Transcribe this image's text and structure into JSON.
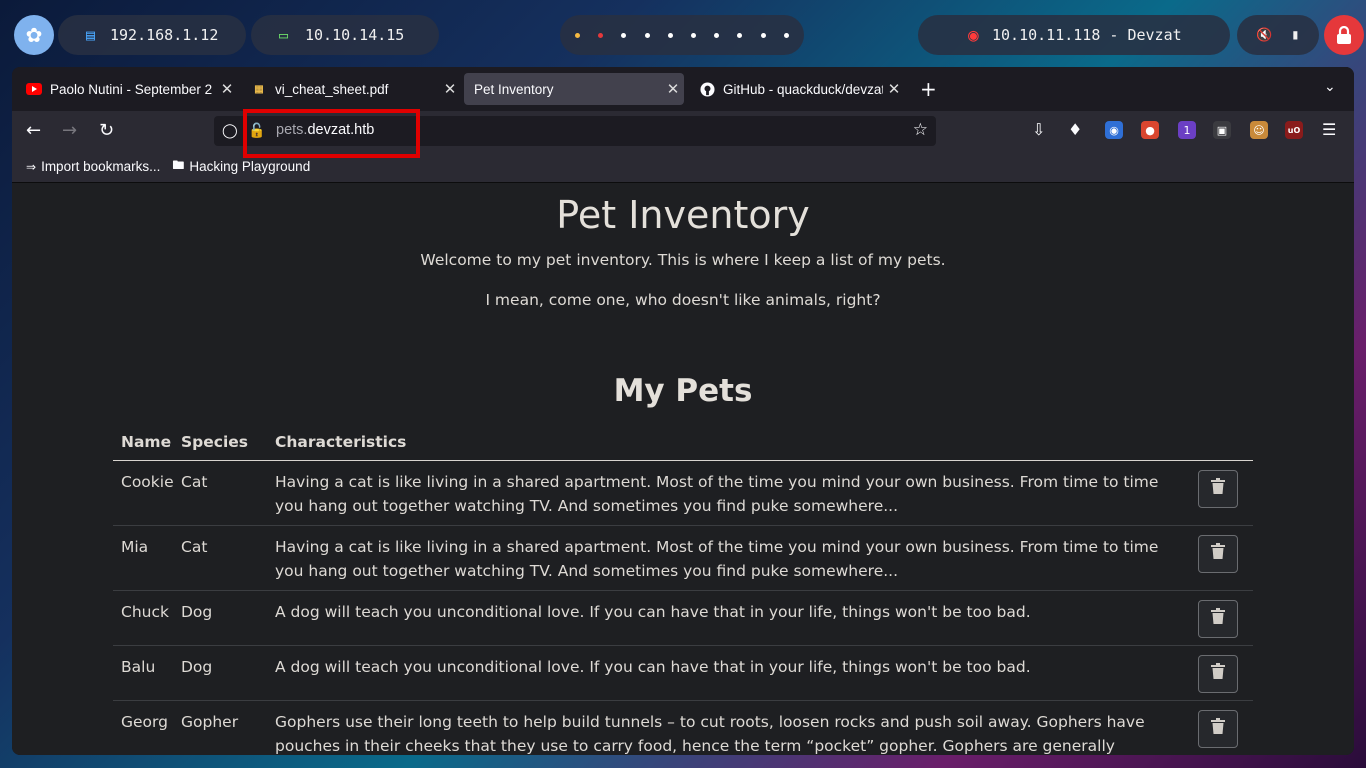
{
  "desktop": {
    "ip_local": "192.168.1.12",
    "ip_vpn": "10.10.14.15",
    "target": "10.10.11.118 - Devzat",
    "workspace_count": 10,
    "colors": {
      "accent_blue": "#7fb2ee",
      "lock_red": "#e5383b"
    }
  },
  "browser": {
    "tabs": [
      {
        "title": "Paolo Nutini - September 2",
        "icon": "youtube-icon"
      },
      {
        "title": "vi_cheat_sheet.pdf",
        "icon": "pdf-icon"
      },
      {
        "title": "Pet Inventory",
        "icon": "none",
        "active": true
      },
      {
        "title": "GitHub - quackduck/devzat",
        "icon": "github-icon"
      }
    ],
    "url": {
      "subdomain": "pets.",
      "domain": "devzat.htb"
    },
    "bookmarks": [
      {
        "label": "Import bookmarks...",
        "icon": "import-icon"
      },
      {
        "label": "Hacking Playground",
        "icon": "folder-icon"
      }
    ]
  },
  "page": {
    "title": "Pet Inventory",
    "lead1": "Welcome to my pet inventory. This is where I keep a list of my pets.",
    "lead2": "I mean, come one, who doesn't like animals, right?",
    "section_title": "My Pets",
    "table": {
      "headers": {
        "name": "Name",
        "species": "Species",
        "characteristics": "Characteristics"
      },
      "rows": [
        {
          "name": "Cookie",
          "species": "Cat",
          "characteristics": "Having a cat is like living in a shared apartment. Most of the time you mind your own business. From time to time you hang out together watching TV. And sometimes you find puke somewhere..."
        },
        {
          "name": "Mia",
          "species": "Cat",
          "characteristics": "Having a cat is like living in a shared apartment. Most of the time you mind your own business. From time to time you hang out together watching TV. And sometimes you find puke somewhere..."
        },
        {
          "name": "Chuck",
          "species": "Dog",
          "characteristics": "A dog will teach you unconditional love. If you can have that in your life, things won't be too bad."
        },
        {
          "name": "Balu",
          "species": "Dog",
          "characteristics": "A dog will teach you unconditional love. If you can have that in your life, things won't be too bad."
        },
        {
          "name": "Georg",
          "species": "Gopher",
          "characteristics": "Gophers use their long teeth to help build tunnels – to cut roots, loosen rocks and push soil away. Gophers have pouches in their cheeks that they use to carry food, hence the term “pocket” gopher. Gophers are generally solitary"
        }
      ]
    }
  }
}
